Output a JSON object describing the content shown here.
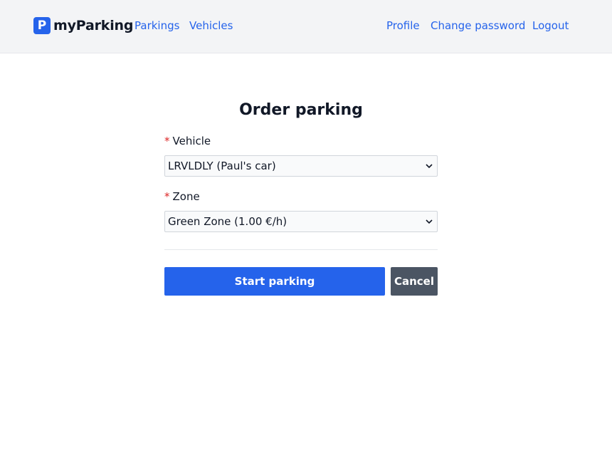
{
  "brand": {
    "icon_letter": "P",
    "name": "myParking",
    "color": "#2563eb"
  },
  "nav": {
    "left": [
      {
        "label": "Parkings"
      },
      {
        "label": "Vehicles"
      }
    ],
    "right": [
      {
        "label": "Profile"
      },
      {
        "label": "Change password"
      },
      {
        "label": "Logout"
      }
    ]
  },
  "form": {
    "title": "Order parking",
    "required_marker": "*",
    "vehicle": {
      "label": "Vehicle",
      "value": "LRVLDLY (Paul's car)"
    },
    "zone": {
      "label": "Zone",
      "value": "Green Zone (1.00 €/h)"
    },
    "submit_label": "Start parking",
    "cancel_label": "Cancel"
  },
  "colors": {
    "accent": "#2563eb",
    "required": "#dc2626",
    "cancel": "#4b5563"
  }
}
